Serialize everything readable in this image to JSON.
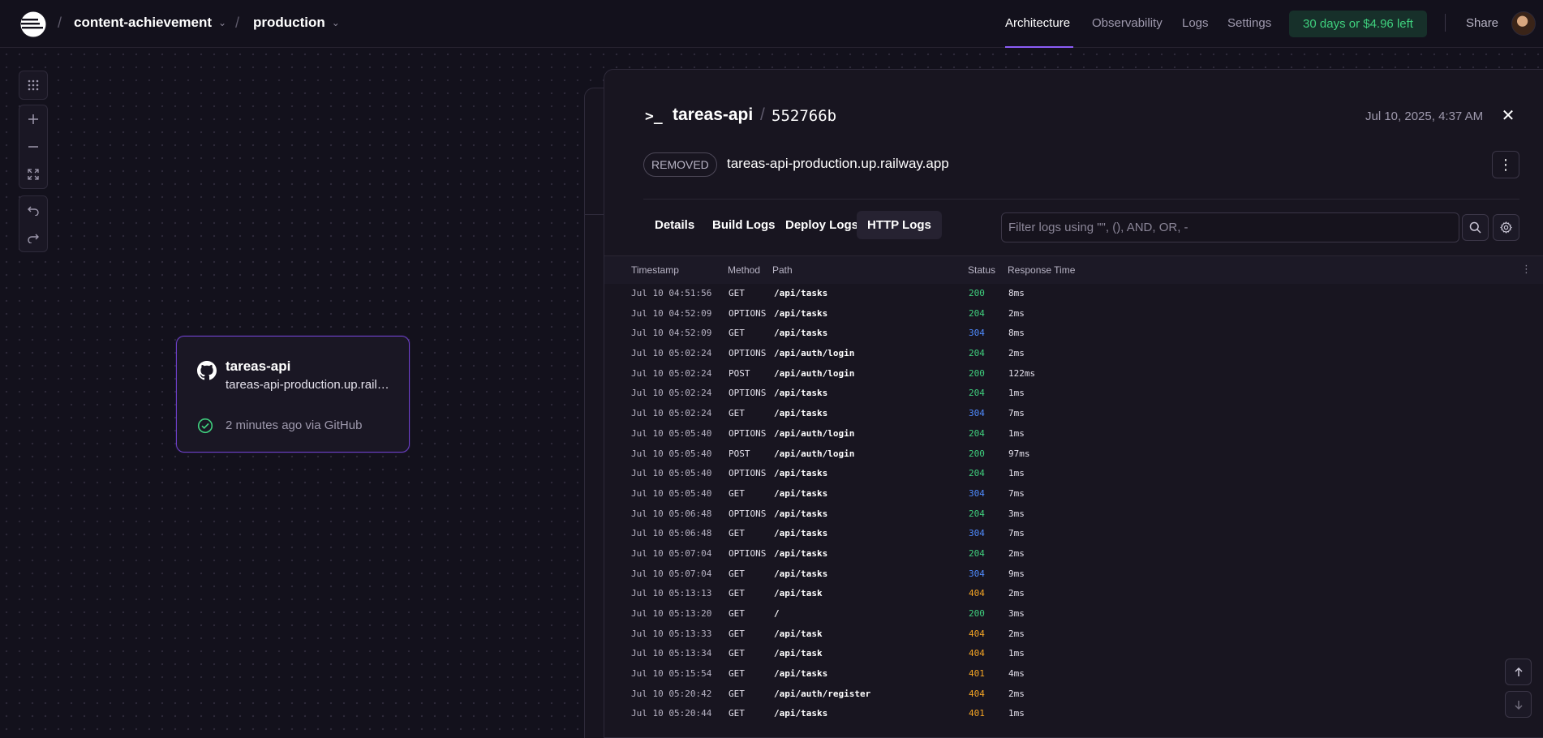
{
  "header": {
    "project": "content-achievement",
    "environment": "production",
    "nav": [
      "Architecture",
      "Observability",
      "Logs",
      "Settings"
    ],
    "trial": "30 days or $4.96 left",
    "share": "Share"
  },
  "canvas": {
    "service": {
      "name": "tareas-api",
      "url": "tareas-api-production.up.railway.app",
      "deploy": "2 minutes ago via GitHub"
    }
  },
  "panel": {
    "term_icon": ">_",
    "title": "tareas-api",
    "separator": "/",
    "commit": "552766b",
    "date": "Jul 10, 2025, 4:37 AM",
    "status_badge": "REMOVED",
    "url": "tareas-api-production.up.railway.app",
    "tabs": [
      "Details",
      "Build Logs",
      "Deploy Logs",
      "HTTP Logs"
    ],
    "active_tab": "HTTP Logs",
    "filter_placeholder": "Filter logs using \"\", (), AND, OR, -",
    "columns": [
      "Timestamp",
      "Method",
      "Path",
      "Status",
      "Response Time"
    ],
    "logs": [
      {
        "ts": "Jul 10 04:51:56",
        "method": "GET",
        "path": "/api/tasks",
        "status": "200",
        "time": "8ms"
      },
      {
        "ts": "Jul 10 04:52:09",
        "method": "OPTIONS",
        "path": "/api/tasks",
        "status": "204",
        "time": "2ms"
      },
      {
        "ts": "Jul 10 04:52:09",
        "method": "GET",
        "path": "/api/tasks",
        "status": "304",
        "time": "8ms"
      },
      {
        "ts": "Jul 10 05:02:24",
        "method": "OPTIONS",
        "path": "/api/auth/login",
        "status": "204",
        "time": "2ms"
      },
      {
        "ts": "Jul 10 05:02:24",
        "method": "POST",
        "path": "/api/auth/login",
        "status": "200",
        "time": "122ms"
      },
      {
        "ts": "Jul 10 05:02:24",
        "method": "OPTIONS",
        "path": "/api/tasks",
        "status": "204",
        "time": "1ms"
      },
      {
        "ts": "Jul 10 05:02:24",
        "method": "GET",
        "path": "/api/tasks",
        "status": "304",
        "time": "7ms"
      },
      {
        "ts": "Jul 10 05:05:40",
        "method": "OPTIONS",
        "path": "/api/auth/login",
        "status": "204",
        "time": "1ms"
      },
      {
        "ts": "Jul 10 05:05:40",
        "method": "POST",
        "path": "/api/auth/login",
        "status": "200",
        "time": "97ms"
      },
      {
        "ts": "Jul 10 05:05:40",
        "method": "OPTIONS",
        "path": "/api/tasks",
        "status": "204",
        "time": "1ms"
      },
      {
        "ts": "Jul 10 05:05:40",
        "method": "GET",
        "path": "/api/tasks",
        "status": "304",
        "time": "7ms"
      },
      {
        "ts": "Jul 10 05:06:48",
        "method": "OPTIONS",
        "path": "/api/tasks",
        "status": "204",
        "time": "3ms"
      },
      {
        "ts": "Jul 10 05:06:48",
        "method": "GET",
        "path": "/api/tasks",
        "status": "304",
        "time": "7ms"
      },
      {
        "ts": "Jul 10 05:07:04",
        "method": "OPTIONS",
        "path": "/api/tasks",
        "status": "204",
        "time": "2ms"
      },
      {
        "ts": "Jul 10 05:07:04",
        "method": "GET",
        "path": "/api/tasks",
        "status": "304",
        "time": "9ms"
      },
      {
        "ts": "Jul 10 05:13:13",
        "method": "GET",
        "path": "/api/task",
        "status": "404",
        "time": "2ms"
      },
      {
        "ts": "Jul 10 05:13:20",
        "method": "GET",
        "path": "/",
        "status": "200",
        "time": "3ms"
      },
      {
        "ts": "Jul 10 05:13:33",
        "method": "GET",
        "path": "/api/task",
        "status": "404",
        "time": "2ms"
      },
      {
        "ts": "Jul 10 05:13:34",
        "method": "GET",
        "path": "/api/task",
        "status": "404",
        "time": "1ms"
      },
      {
        "ts": "Jul 10 05:15:54",
        "method": "GET",
        "path": "/api/tasks",
        "status": "401",
        "time": "4ms"
      },
      {
        "ts": "Jul 10 05:20:42",
        "method": "GET",
        "path": "/api/auth/register",
        "status": "404",
        "time": "2ms"
      },
      {
        "ts": "Jul 10 05:20:44",
        "method": "GET",
        "path": "/api/tasks",
        "status": "401",
        "time": "1ms"
      }
    ]
  },
  "colors": {
    "accent": "#8b5cf6",
    "success": "#3fd07e",
    "redirect": "#4f8cff",
    "client_error": "#f5a524",
    "background": "#13111c"
  }
}
